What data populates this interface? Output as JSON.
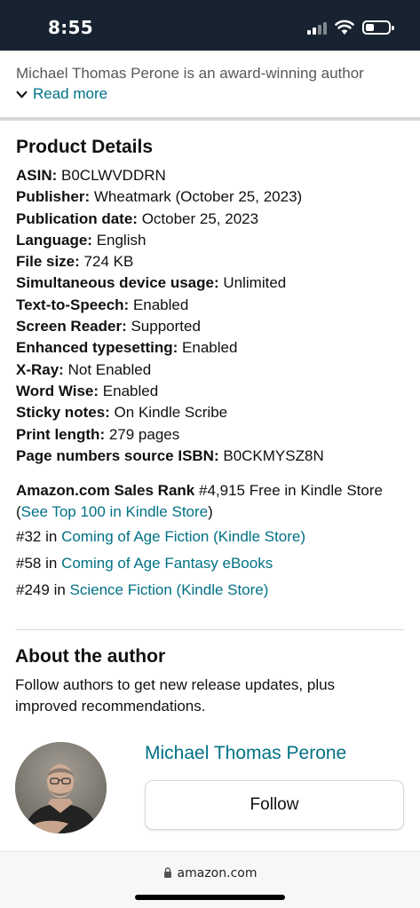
{
  "status_bar": {
    "time": "8:55"
  },
  "description": {
    "text": "Michael Thomas Perone is an award-winning author",
    "read_more": "Read more"
  },
  "product_details": {
    "title": "Product Details",
    "rows": [
      {
        "label": "ASIN:",
        "value": "B0CLWVDDRN"
      },
      {
        "label": "Publisher:",
        "value": "Wheatmark (October 25, 2023)"
      },
      {
        "label": "Publication date:",
        "value": "October 25, 2023"
      },
      {
        "label": "Language:",
        "value": "English"
      },
      {
        "label": "File size:",
        "value": "724 KB"
      },
      {
        "label": "Simultaneous device usage:",
        "value": "Unlimited"
      },
      {
        "label": "Text-to-Speech:",
        "value": "Enabled"
      },
      {
        "label": "Screen Reader:",
        "value": "Supported"
      },
      {
        "label": "Enhanced typesetting:",
        "value": "Enabled"
      },
      {
        "label": "X-Ray:",
        "value": "Not Enabled"
      },
      {
        "label": "Word Wise:",
        "value": "Enabled"
      },
      {
        "label": "Sticky notes:",
        "value": "On Kindle Scribe"
      },
      {
        "label": "Print length:",
        "value": "279 pages"
      },
      {
        "label": "Page numbers source ISBN:",
        "value": "B0CKMYSZ8N"
      }
    ]
  },
  "sales_rank": {
    "label": "Amazon.com Sales Rank",
    "value": "#4,915 Free in Kindle Store",
    "open_paren": "(",
    "top100_link": "See Top 100 in Kindle Store",
    "close_paren": ")",
    "categories": [
      {
        "rank": "#32",
        "in": "in",
        "link": "Coming of Age Fiction (Kindle Store)"
      },
      {
        "rank": "#58",
        "in": "in",
        "link": "Coming of Age Fantasy eBooks"
      },
      {
        "rank": "#249",
        "in": "in",
        "link": "Science Fiction (Kindle Store)"
      }
    ]
  },
  "about_author": {
    "title": "About the author",
    "subtitle": "Follow authors to get new release updates, plus improved recommendations.",
    "name": "Michael Thomas Perone",
    "follow_label": "Follow"
  },
  "url_bar": {
    "url": "amazon.com"
  },
  "colors": {
    "link": "#007185",
    "status_bar": "#172330",
    "text": "#0f1111"
  },
  "icons": [
    "signal-icon",
    "wifi-icon",
    "battery-icon",
    "chevron-down-icon",
    "lock-icon"
  ]
}
